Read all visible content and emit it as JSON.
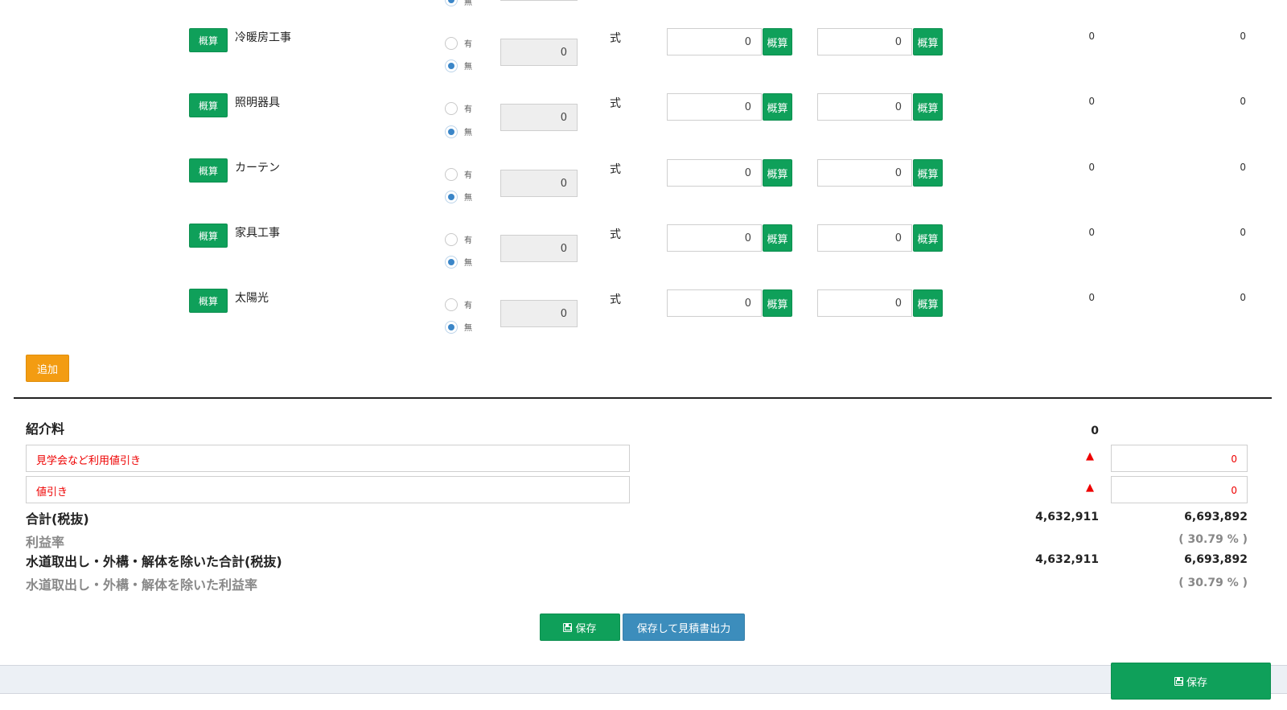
{
  "rows": [
    {
      "btn": "概算",
      "name": "冷暖房工事",
      "opt_yes": "有",
      "opt_no": "無",
      "selected": "無",
      "qty": "0",
      "unit": "式",
      "cost": "0",
      "cost_btn": "概算",
      "price": "0",
      "price_btn": "概算",
      "cost_total": "0",
      "price_total": "0"
    },
    {
      "btn": "概算",
      "name": "照明器具",
      "opt_yes": "有",
      "opt_no": "無",
      "selected": "無",
      "qty": "0",
      "unit": "式",
      "cost": "0",
      "cost_btn": "概算",
      "price": "0",
      "price_btn": "概算",
      "cost_total": "0",
      "price_total": "0"
    },
    {
      "btn": "概算",
      "name": "カーテン",
      "opt_yes": "有",
      "opt_no": "無",
      "selected": "無",
      "qty": "0",
      "unit": "式",
      "cost": "0",
      "cost_btn": "概算",
      "price": "0",
      "price_btn": "概算",
      "cost_total": "0",
      "price_total": "0"
    },
    {
      "btn": "概算",
      "name": "家具工事",
      "opt_yes": "有",
      "opt_no": "無",
      "selected": "無",
      "qty": "0",
      "unit": "式",
      "cost": "0",
      "cost_btn": "概算",
      "price": "0",
      "price_btn": "概算",
      "cost_total": "0",
      "price_total": "0"
    },
    {
      "btn": "概算",
      "name": "太陽光",
      "opt_yes": "有",
      "opt_no": "無",
      "selected": "無",
      "qty": "0",
      "unit": "式",
      "cost": "0",
      "cost_btn": "概算",
      "price": "0",
      "price_btn": "概算",
      "cost_total": "0",
      "price_total": "0"
    }
  ],
  "add_label": "追加",
  "summary": {
    "referral_label": "紹介料",
    "referral_value": "0",
    "discount1_label": "見学会など利用値引き",
    "discount1_mark": "▲",
    "discount1_value": "0",
    "discount2_label": "値引き",
    "discount2_mark": "▲",
    "discount2_value": "0",
    "total_label": "合計(税抜)",
    "total_cost": "4,632,911",
    "total_price": "6,693,892",
    "margin_label": "利益率",
    "margin_value": "( 30.79 % )",
    "total_excl_label": "水道取出し・外構・解体を除いた合計(税抜)",
    "total_excl_cost": "4,632,911",
    "total_excl_price": "6,693,892",
    "margin_excl_label": "水道取出し・外構・解体を除いた利益率",
    "margin_excl_value": "( 30.79 % )"
  },
  "actions": {
    "save_label": "保存",
    "save_export_label": "保存して見積書出力"
  },
  "footer": {
    "save_label": "保存"
  },
  "colors": {
    "green": "#0fa05a",
    "blue": "#3c8dbc",
    "orange": "#f39c12",
    "red": "#e00000"
  }
}
